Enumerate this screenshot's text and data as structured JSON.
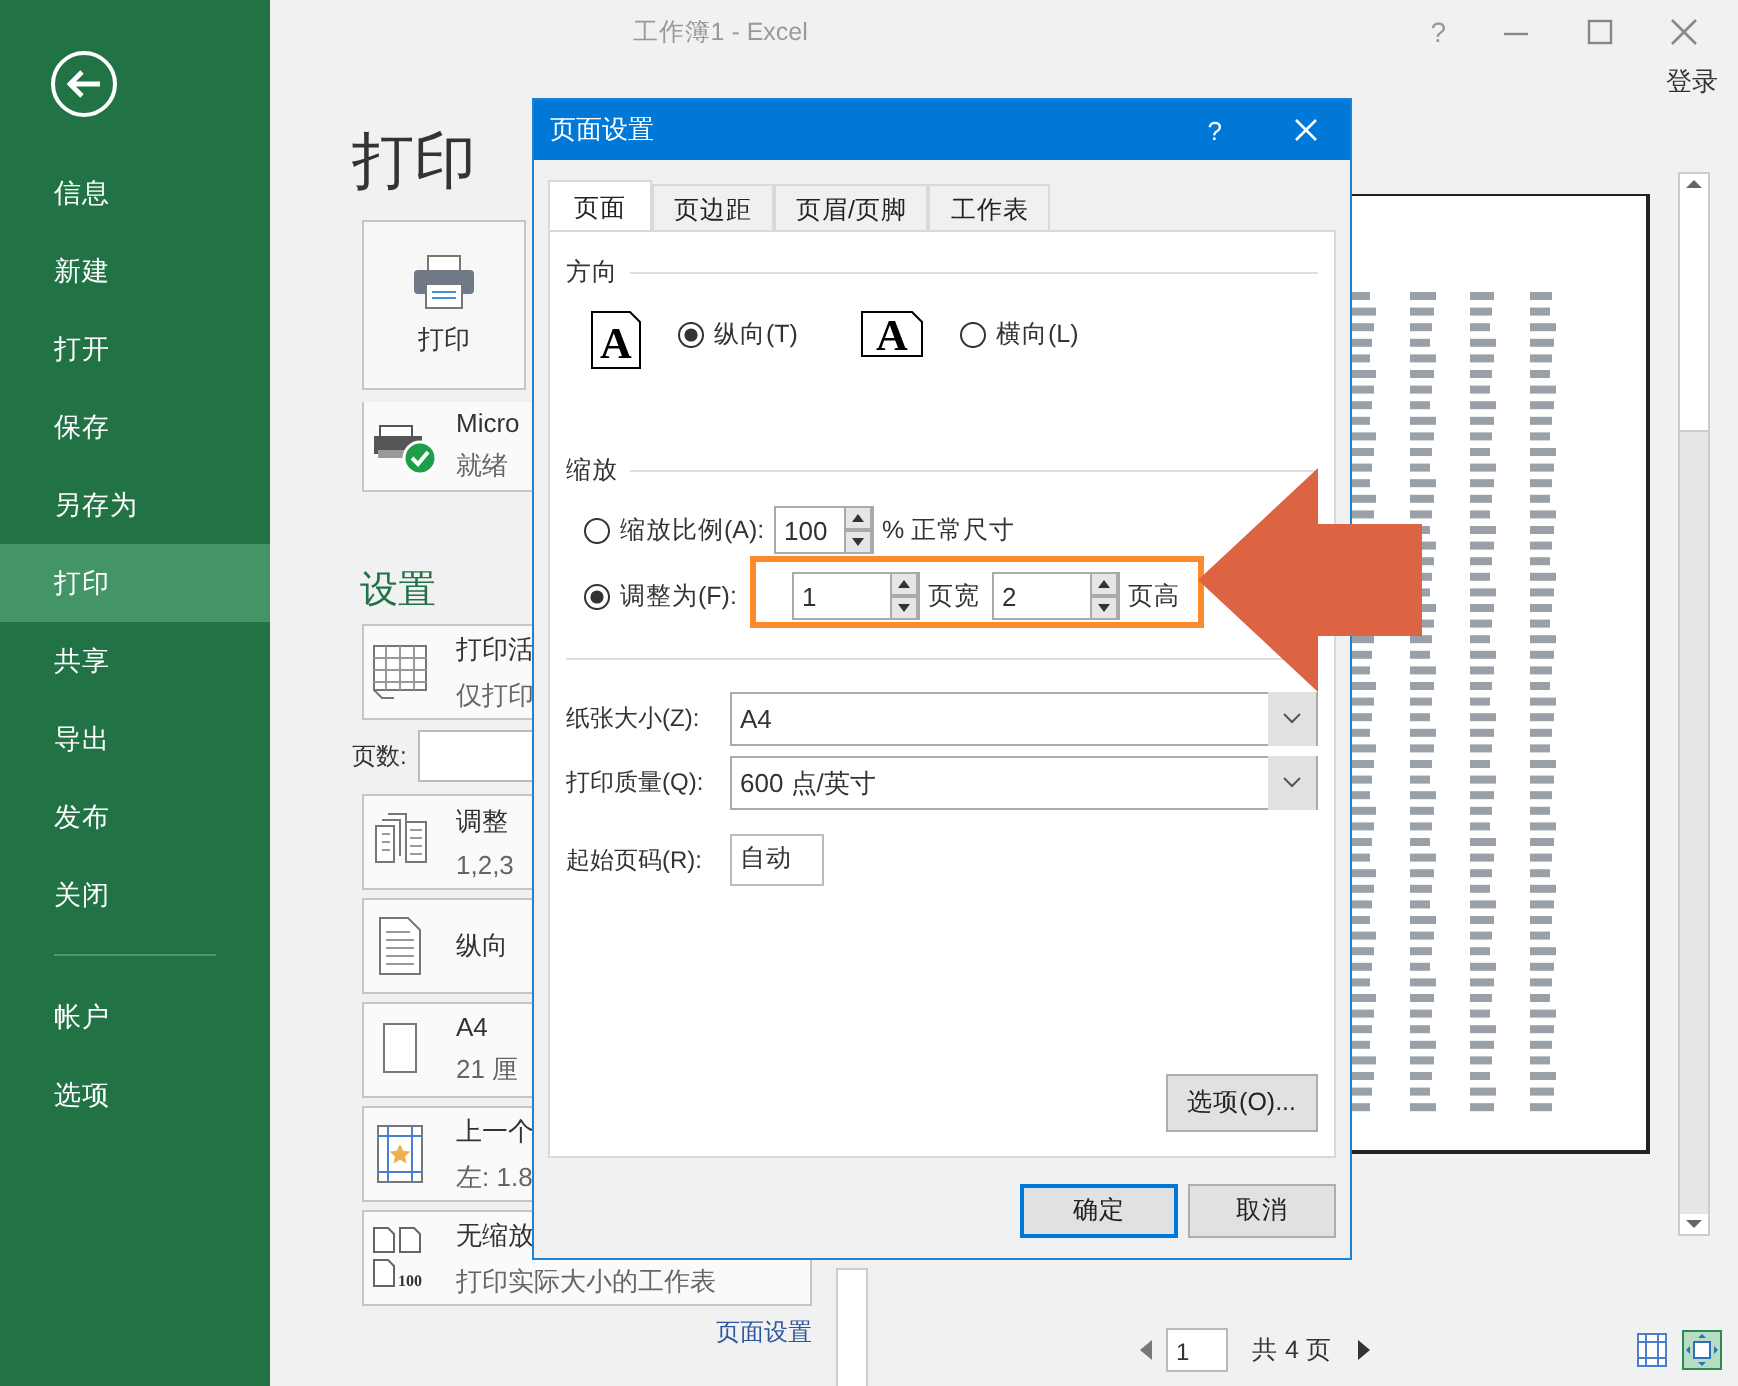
{
  "window": {
    "title": "工作簿1 - Excel",
    "help": "?",
    "sign_in": "登录"
  },
  "sidebar": {
    "items": [
      {
        "label": "信息",
        "selected": false
      },
      {
        "label": "新建",
        "selected": false
      },
      {
        "label": "打开",
        "selected": false
      },
      {
        "label": "保存",
        "selected": false
      },
      {
        "label": "另存为",
        "selected": false
      },
      {
        "label": "打印",
        "selected": true
      },
      {
        "label": "共享",
        "selected": false
      },
      {
        "label": "导出",
        "selected": false
      },
      {
        "label": "发布",
        "selected": false
      },
      {
        "label": "关闭",
        "selected": false
      }
    ],
    "footer_items": [
      {
        "label": "帐户",
        "selected": false
      },
      {
        "label": "选项",
        "selected": false
      }
    ]
  },
  "print_pane": {
    "title": "打印",
    "print_button": "打印",
    "printer": {
      "name": "Micro",
      "status": "就绪"
    },
    "settings_title": "设置",
    "settings": [
      {
        "kind": "sheets",
        "title": "打印活",
        "subtitle": "仅打印"
      },
      {
        "kind": "pages",
        "label": "页数:"
      },
      {
        "kind": "collate",
        "title": "调整",
        "subtitle": "1,2,3"
      },
      {
        "kind": "orientation",
        "title": "纵向"
      },
      {
        "kind": "paper",
        "title": "A4",
        "subtitle": "21 厘"
      },
      {
        "kind": "margins",
        "title": "上一个",
        "subtitle": "左: 1.8"
      },
      {
        "kind": "scaling",
        "title": "无缩放",
        "subtitle": "打印实际大小的工作表",
        "badge": "100"
      }
    ],
    "page_setup_link": "页面设置"
  },
  "preview": {
    "current_page": "1",
    "page_count": "共 4 页"
  },
  "dialog": {
    "title": "页面设置",
    "help": "?",
    "tabs": [
      {
        "label": "页面",
        "selected": true
      },
      {
        "label": "页边距",
        "selected": false
      },
      {
        "label": "页眉/页脚",
        "selected": false
      },
      {
        "label": "工作表",
        "selected": false
      }
    ],
    "orientation": {
      "heading": "方向",
      "options": [
        {
          "kind": "portrait",
          "icon_letter": "A",
          "label": "纵向(T)",
          "selected": true
        },
        {
          "kind": "landscape",
          "icon_letter": "A",
          "label": "横向(L)",
          "selected": false
        }
      ]
    },
    "scaling": {
      "heading": "缩放",
      "options": [
        {
          "kind": "percent",
          "label": "缩放比例(A):",
          "selected": false,
          "value": "100",
          "suffix": "% 正常尺寸"
        },
        {
          "kind": "fit",
          "label": "调整为(F):",
          "selected": true,
          "wide_value": "1",
          "wide_label": "页宽",
          "tall_value": "2",
          "tall_label": "页高"
        }
      ]
    },
    "paper_size": {
      "label": "纸张大小(Z):",
      "value": "A4"
    },
    "print_quality": {
      "label": "打印质量(Q):",
      "value": "600 点/英寸"
    },
    "first_page": {
      "label": "起始页码(R):",
      "value": "自动"
    },
    "options_button": "选项(O)...",
    "ok": "确定",
    "cancel": "取消"
  }
}
